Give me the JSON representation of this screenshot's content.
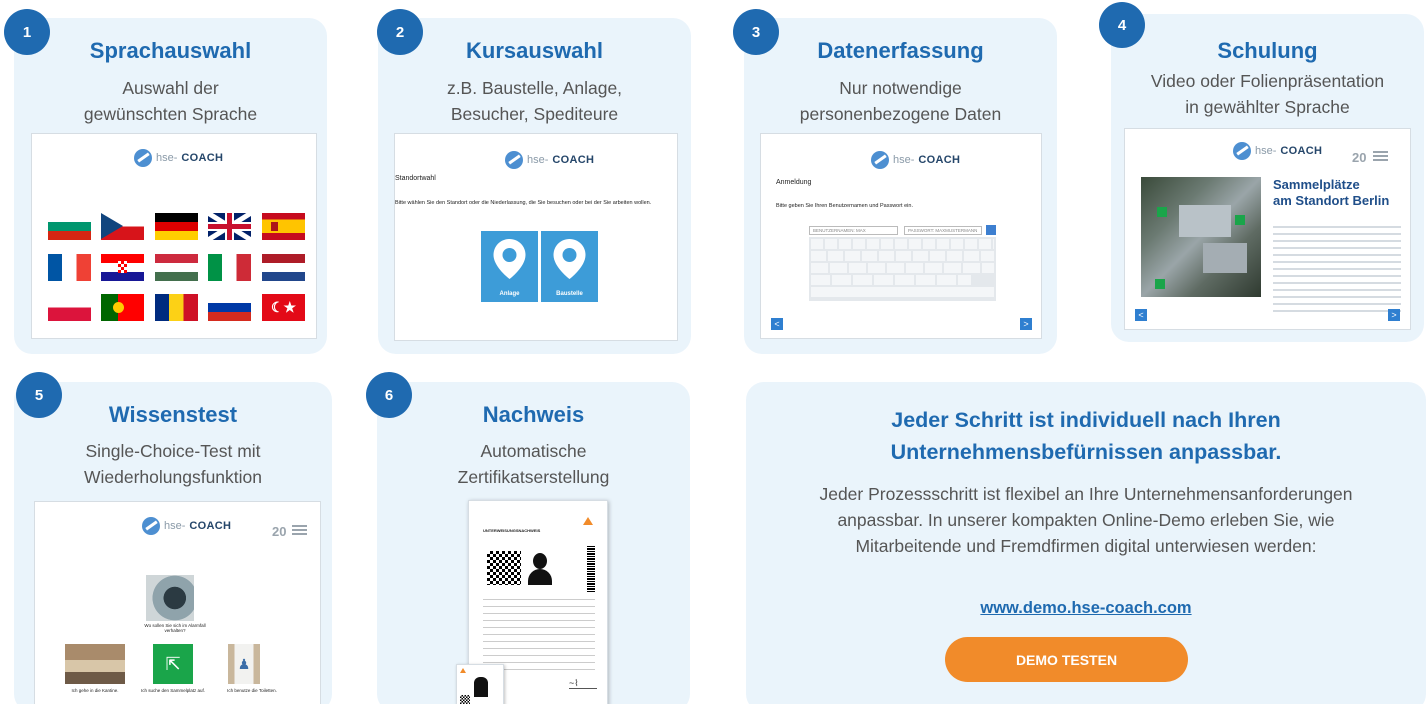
{
  "steps": [
    {
      "number": "1",
      "title": "Sprachauswahl",
      "subtitle_line1": "Auswahl der",
      "subtitle_line2": "gewünschten Sprache"
    },
    {
      "number": "2",
      "title": "Kursauswahl",
      "subtitle_line1": "z.B. Baustelle, Anlage,",
      "subtitle_line2": "Besucher, Spediteure"
    },
    {
      "number": "3",
      "title": "Datenerfassung",
      "subtitle_line1": "Nur notwendige",
      "subtitle_line2": "personenbezogene Daten"
    },
    {
      "number": "4",
      "title": "Schulung",
      "subtitle_line1": "Video oder Folienpräsentation",
      "subtitle_line2": "in gewählter Sprache"
    },
    {
      "number": "5",
      "title": "Wissenstest",
      "subtitle_line1": "Single-Choice-Test mit",
      "subtitle_line2": "Wiederholungsfunktion"
    },
    {
      "number": "6",
      "title": "Nachweis",
      "subtitle_line1": "Automatische",
      "subtitle_line2": "Zertifikatserstellung"
    }
  ],
  "logo": {
    "prefix": "hse-",
    "brand": "COACH"
  },
  "shot2": {
    "heading": "Standortwahl",
    "text": "Bitte wählen Sie den Standort oder die Niederlassung, die Sie besuchen oder bei der Sie arbeiten wollen.",
    "tile1": "Anlage",
    "tile2": "Baustelle"
  },
  "shot3": {
    "heading": "Anmeldung",
    "text": "Bitte geben Sie Ihren Benutzernamen und Passwort ein.",
    "user_placeholder": "BENUTZERNAMEN: MAX",
    "pass_placeholder": "PASSWORT: MAXMUSTERMANN"
  },
  "shot4": {
    "page": "20",
    "title_line1": "Sammelplätze",
    "title_line2": "am Standort Berlin"
  },
  "shot5": {
    "page": "20",
    "question": "Wo sollen Sie sich im Alarmfall verhalten?",
    "answer1": "Ich gehe in die Kantine.",
    "answer2": "Ich suche den Sammelplatz auf.",
    "answer3": "Ich benutze die Toiletten."
  },
  "shot6": {
    "doc_title": "UNTERWEISUNGSNACHWEIS"
  },
  "right_panel": {
    "title_line1": "Jeder Schritt ist individuell nach Ihren",
    "title_line2": "Unternehmensbefürnissen anpassbar.",
    "text_line1": "Jeder Prozessschritt ist flexibel an Ihre Unternehmensanforderungen",
    "text_line2": "anpassbar. In unserer kompakten Online-Demo erleben Sie, wie",
    "text_line3": "Mitarbeitende und Fremdfirmen digital unterwiesen werden:",
    "link": "www.demo.hse-coach.com",
    "cta": "DEMO TESTEN"
  },
  "colors": {
    "accent": "#1f6ab0",
    "card_bg": "#eaf4fb",
    "cta": "#f18b2a"
  }
}
